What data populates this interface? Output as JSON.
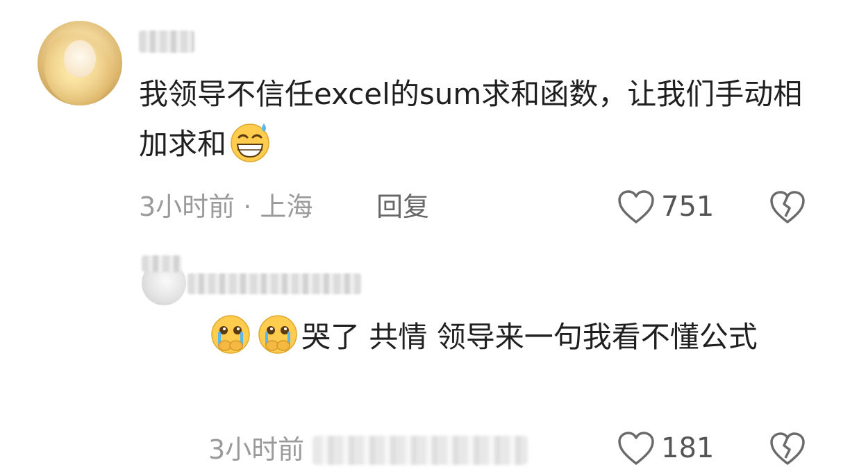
{
  "comments": [
    {
      "text_part1": "我领导不信任excel的sum求和函数，让我们手动相加求和",
      "emoji": [
        "grin-sweat"
      ],
      "time_location": "3小时前 · 上海",
      "reply_label": "回复",
      "like_count": "751"
    },
    {
      "text_part1": "哭了 共情  领导来一句我看不懂公式",
      "emoji": [
        "crying-face",
        "crying-face"
      ],
      "time": "3小时前",
      "like_count": "181"
    }
  ],
  "icons": {
    "like": "heart-outline-icon",
    "dislike": "broken-heart-icon"
  },
  "colors": {
    "text": "#1f1f1f",
    "meta": "#9a9a9a",
    "icon": "#666666"
  }
}
